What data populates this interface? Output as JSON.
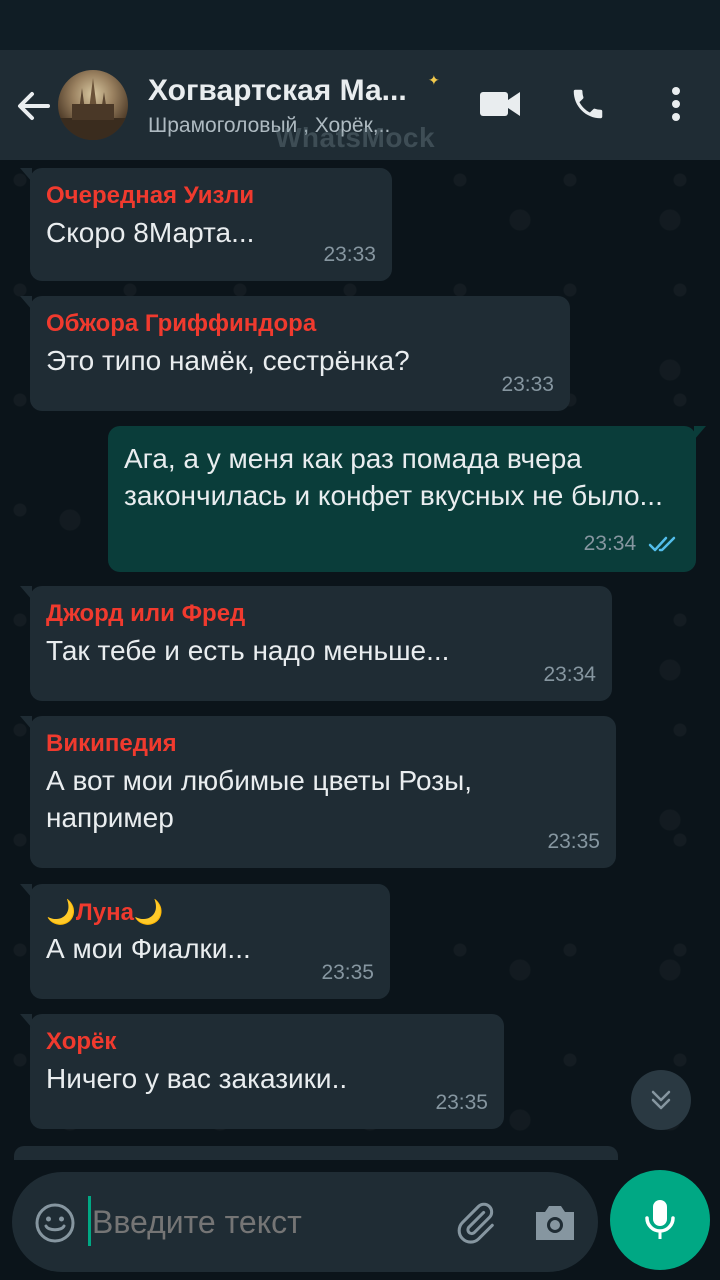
{
  "header": {
    "title": "Хогвартская Ма...",
    "subtitle": "Шрамоголовый , Хорёк,..",
    "watermark": "WhatsMock"
  },
  "messages": [
    {
      "sender": "Очередная Уизли",
      "text": "Скоро 8Марта...",
      "time": "23:33",
      "outgoing": false
    },
    {
      "sender": "Обжора Гриффиндора",
      "text": "Это типо намёк, сестрёнка?",
      "time": "23:33",
      "outgoing": false
    },
    {
      "sender": "",
      "text": "Ага, а у меня как раз помада вчера закончилась и конфет вкусных не было...",
      "time": "23:34",
      "outgoing": true,
      "status": "read"
    },
    {
      "sender": "Джорд или Фред",
      "text": "Так тебе и есть надо меньше...",
      "time": "23:34",
      "outgoing": false
    },
    {
      "sender": "Википедия",
      "text": "А вот мои любимые цветы Розы, например",
      "time": "23:35",
      "outgoing": false
    },
    {
      "sender": "🌙Луна🌙",
      "text": "А мои Фиалки...",
      "time": "23:35",
      "outgoing": false
    },
    {
      "sender": "Хорёк",
      "text": "Ничего у вас заказики..",
      "time": "23:35",
      "outgoing": false
    }
  ],
  "composer": {
    "placeholder": "Введите текст"
  },
  "colors": {
    "accent": "#00a884",
    "sender_name": "#f03a2e",
    "read_ticks": "#53bdeb",
    "bubble_in": "#1f2c34",
    "bubble_out": "#0a3d3a"
  }
}
